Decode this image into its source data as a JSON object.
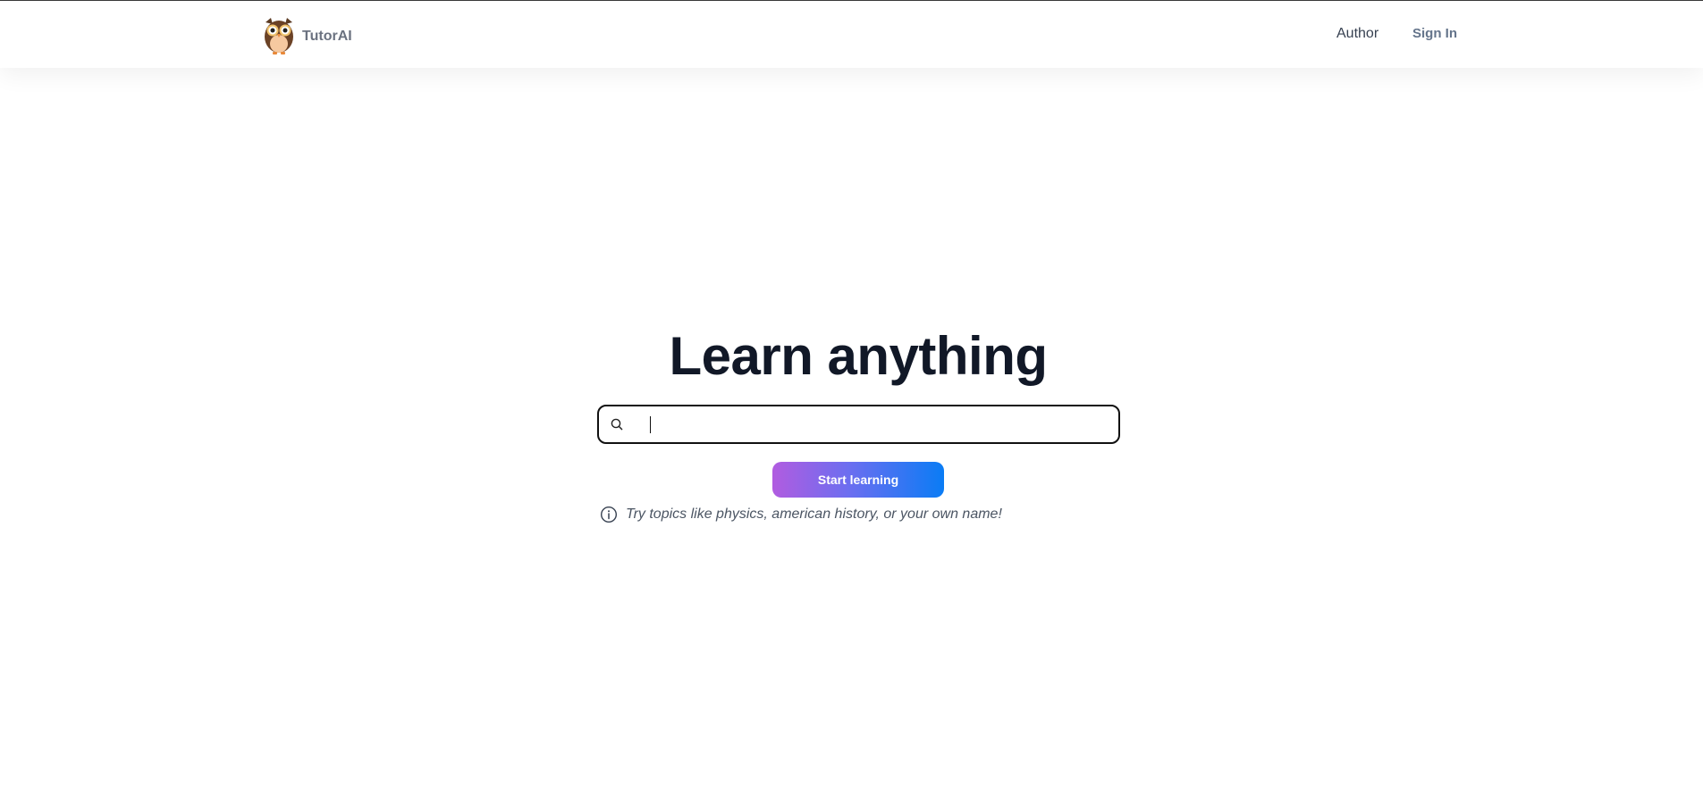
{
  "header": {
    "brand_name": "TutorAI",
    "logo_icon": "owl-icon",
    "nav": {
      "author_label": "Author",
      "signin_label": "Sign In"
    }
  },
  "main": {
    "title": "Learn anything",
    "search": {
      "value": "",
      "placeholder": "",
      "icon": "search-icon"
    },
    "start_button_label": "Start learning",
    "hint": {
      "icon": "info-icon",
      "text": "Try topics like physics, american history, or your own name!"
    }
  },
  "colors": {
    "title": "#111827",
    "brand_text": "#6b7280",
    "button_gradient_start": "#b15ce0",
    "button_gradient_end": "#0a7cf5"
  }
}
